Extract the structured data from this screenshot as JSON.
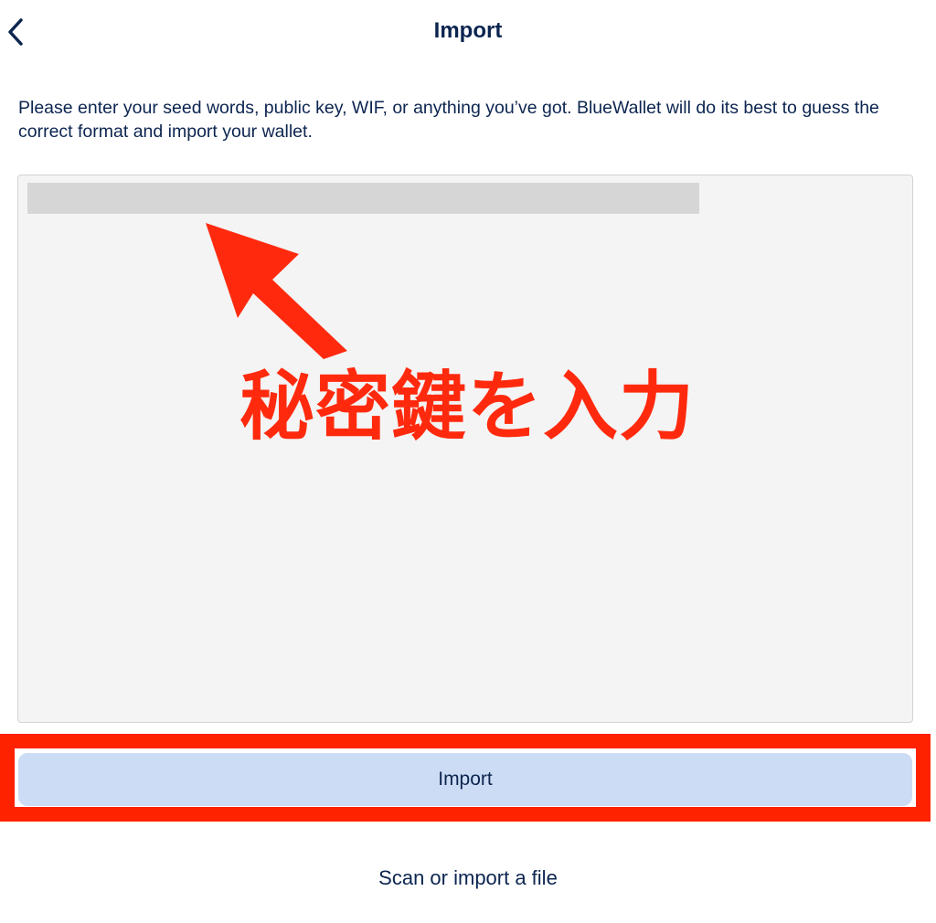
{
  "header": {
    "title": "Import",
    "back_icon": "chevron-left-icon"
  },
  "description": "Please enter your seed words, public key, WIF, or anything you’ve got. BlueWallet will do its best to guess the correct format and import your wallet.",
  "seed_input": {
    "value_redacted": true
  },
  "annotation": {
    "label": "秘密鍵を入力",
    "color": "#ff2a0e"
  },
  "actions": {
    "import_label": "Import",
    "scan_label": "Scan or import a file"
  },
  "colors": {
    "text": "#0c2550",
    "button_bg": "#ccdcf4",
    "input_bg": "#f4f4f4",
    "highlight": "#ff2200"
  }
}
